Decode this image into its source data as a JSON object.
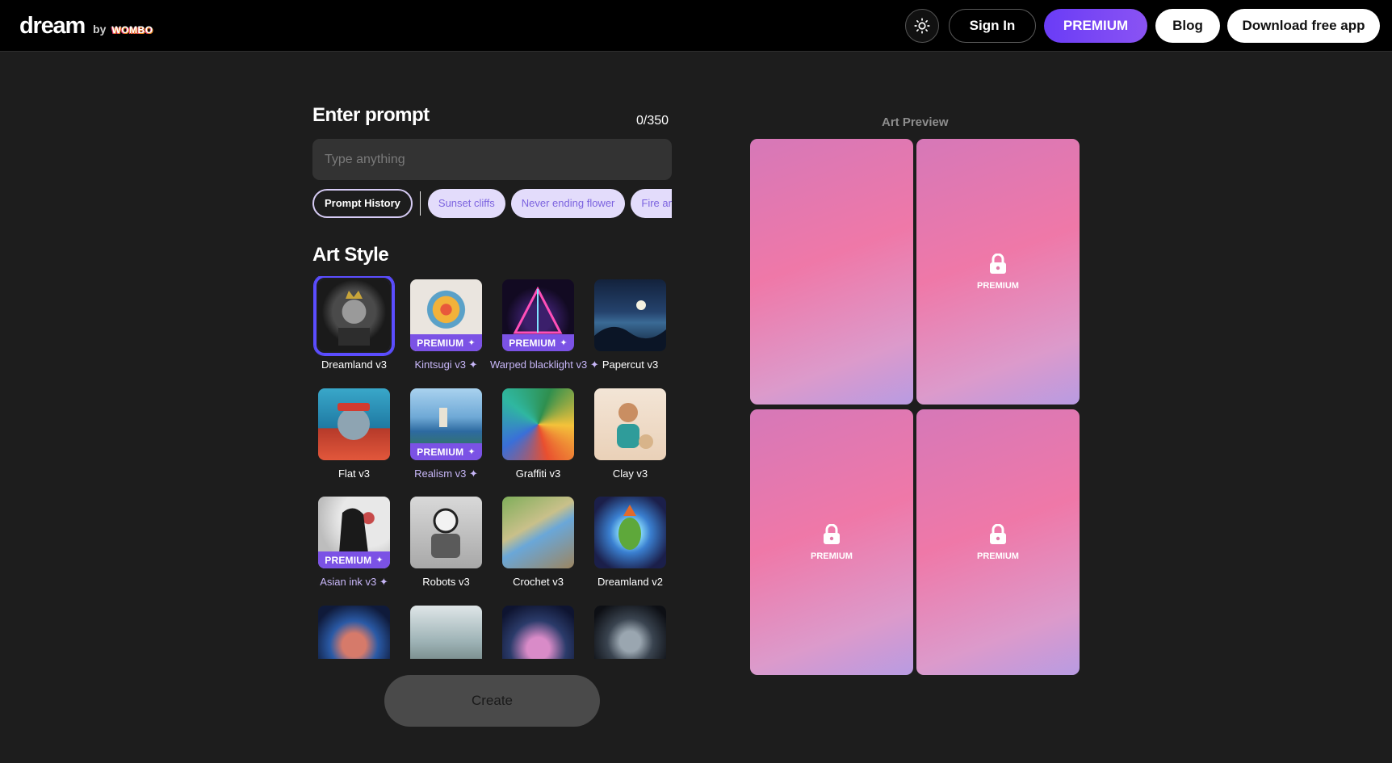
{
  "header": {
    "logo_main": "dream",
    "logo_by": "by",
    "logo_brand": "WOMBO",
    "sign_in": "Sign In",
    "premium": "PREMIUM",
    "blog": "Blog",
    "download": "Download free app"
  },
  "prompt": {
    "title": "Enter prompt",
    "char_count": "0/350",
    "value": "",
    "placeholder": "Type anything",
    "history_label": "Prompt History",
    "suggestions": [
      "Sunset cliffs",
      "Never ending flower",
      "Fire and w"
    ]
  },
  "art_style": {
    "title": "Art Style",
    "premium_badge": "PREMIUM",
    "styles": [
      {
        "label": "Dreamland v3",
        "premium": false,
        "selected": true
      },
      {
        "label": "Kintsugi v3",
        "premium": true
      },
      {
        "label": "Warped blacklight v3",
        "premium": true
      },
      {
        "label": "Papercut v3",
        "premium": false
      },
      {
        "label": "Flat v3",
        "premium": false
      },
      {
        "label": "Realism v3",
        "premium": true
      },
      {
        "label": "Graffiti v3",
        "premium": false
      },
      {
        "label": "Clay v3",
        "premium": false
      },
      {
        "label": "Asian ink v3",
        "premium": true
      },
      {
        "label": "Robots v3",
        "premium": false
      },
      {
        "label": "Crochet v3",
        "premium": false
      },
      {
        "label": "Dreamland v2",
        "premium": false
      }
    ]
  },
  "create_button": "Create",
  "preview": {
    "title": "Art Preview",
    "lock_label": "PREMIUM"
  },
  "colors": {
    "accent": "#6a3cf6",
    "premium_badge": "#7b52e5",
    "chip_bg": "#e3dcfb",
    "chip_text": "#7c63df"
  }
}
